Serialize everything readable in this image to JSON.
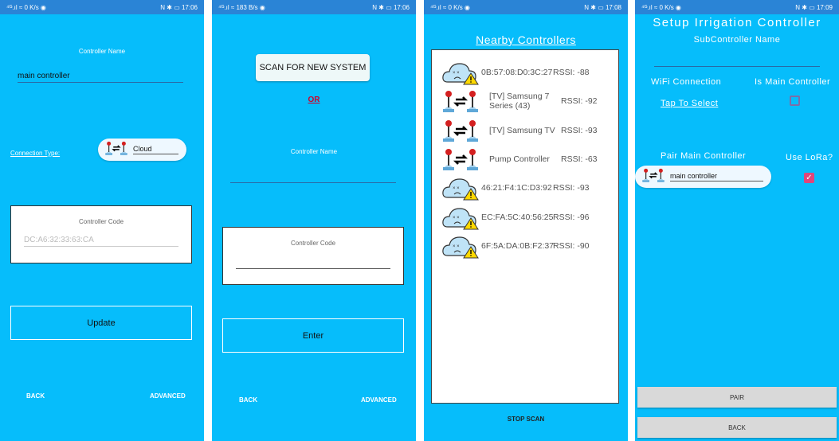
{
  "screens": [
    {
      "status": {
        "left": "⁴ᴳ.ıl ≈ 0 K/s ◉",
        "right": "N ✱ ▭ 17:06"
      },
      "controller_name_label": "Controller Name",
      "controller_name_value": "main controller",
      "connection_type_label": "Connection Type:",
      "connection_type_value": "Cloud",
      "controller_code_label": "Controller Code",
      "controller_code_value": "DC:A6:32:33:63:CA",
      "update_label": "Update",
      "back_label": "BACK",
      "advanced_label": "ADVANCED"
    },
    {
      "status": {
        "left": "⁴ᴳ.ıl ≈ 183 B/s ◉",
        "right": "N ✱ ▭ 17:06"
      },
      "scan_label": "SCAN FOR NEW SYSTEM",
      "or_label": "OR",
      "controller_name_label": "Controller Name",
      "controller_code_label": "Controller Code",
      "enter_label": "Enter",
      "back_label": "BACK",
      "advanced_label": "ADVANCED"
    },
    {
      "status": {
        "left": "⁴ᴳ.ıl ≈ 0 K/s ◉",
        "right": "N ✱ ▭ 17:08"
      },
      "title": "Nearby Controllers",
      "devices": [
        {
          "icon": "cloud-error",
          "name": "0B:57:08:D0:3C:27",
          "rssi": "RSSI: -88"
        },
        {
          "icon": "joystick-link",
          "name": "[TV] Samsung 7 Series (43)",
          "rssi": "RSSI: -92"
        },
        {
          "icon": "joystick-link",
          "name": "[TV] Samsung TV",
          "rssi": "RSSI: -93"
        },
        {
          "icon": "joystick-link",
          "name": "Pump Controller",
          "rssi": "RSSI: -63"
        },
        {
          "icon": "cloud-error",
          "name": "46:21:F4:1C:D3:92",
          "rssi": "RSSI: -93"
        },
        {
          "icon": "cloud-error",
          "name": "EC:FA:5C:40:56:25",
          "rssi": "RSSI: -96"
        },
        {
          "icon": "cloud-error",
          "name": "6F:5A:DA:0B:F2:37",
          "rssi": "RSSI: -90"
        }
      ],
      "stop_scan_label": "STOP SCAN"
    },
    {
      "status": {
        "left": "⁴ᴳ.ıl ≈ 0 K/s ◉",
        "right": "N ✱ ▭ 17:09"
      },
      "title": "Setup Irrigation Controller",
      "subcontroller_name_label": "SubController Name",
      "wifi_label": "WiFi Connection",
      "wifi_value": "Tap To Select",
      "is_main_label": "Is Main Controller",
      "is_main_checked": false,
      "pair_main_label": "Pair Main Controller",
      "pair_main_value": "main controller",
      "use_lora_label": "Use LoRa?",
      "use_lora_checked": true,
      "pair_label": "PAIR",
      "back_label": "BACK"
    }
  ],
  "colors": {
    "background": "#06bdfb",
    "status_bar": "#2a84d6",
    "checkbox_checked": "#e0457b",
    "or": "#d0002a"
  }
}
